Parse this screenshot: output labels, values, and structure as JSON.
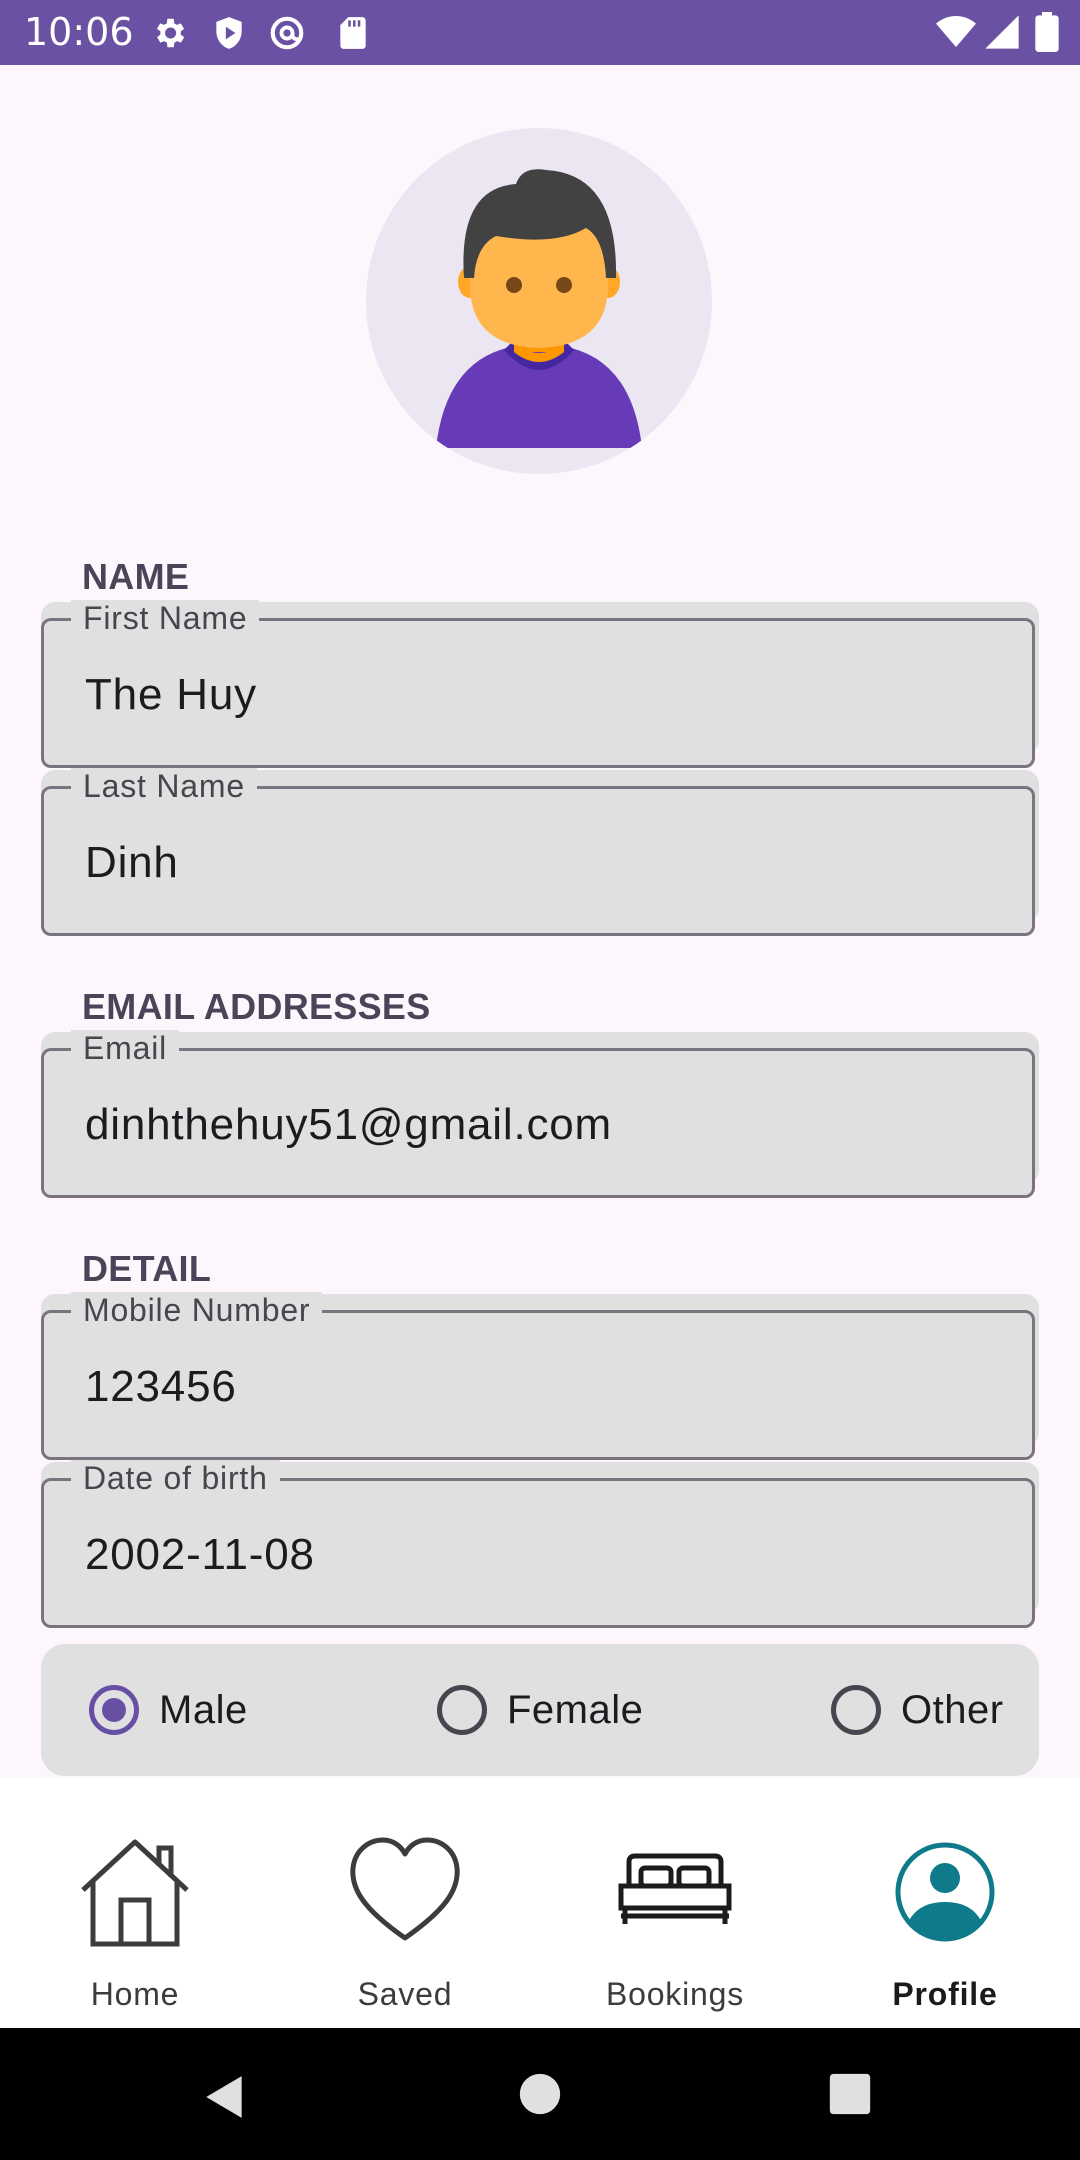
{
  "status_bar": {
    "time": "10:06",
    "icons": [
      "gear-icon",
      "shield-icon",
      "at-sign-icon",
      "sd-card-icon",
      "wifi-icon",
      "signal-icon",
      "battery-icon"
    ]
  },
  "avatar": {
    "icon": "user-avatar"
  },
  "sections": {
    "name": "NAME",
    "email": "EMAIL ADDRESSES",
    "detail": "DETAIL"
  },
  "fields": {
    "first_name": {
      "label": "First Name",
      "value": "The Huy"
    },
    "last_name": {
      "label": "Last Name",
      "value": "Dinh"
    },
    "email": {
      "label": "Email",
      "value": "dinhthehuy51@gmail.com"
    },
    "mobile": {
      "label": "Mobile Number",
      "value": "123456"
    },
    "dob": {
      "label": "Date of birth",
      "value": "2002-11-08"
    }
  },
  "gender": {
    "options": [
      "Male",
      "Female",
      "Other"
    ],
    "selected": "Male"
  },
  "bottom_nav": {
    "items": [
      {
        "label": "Home",
        "icon": "home-icon"
      },
      {
        "label": "Saved",
        "icon": "heart-icon"
      },
      {
        "label": "Bookings",
        "icon": "bed-icon"
      },
      {
        "label": "Profile",
        "icon": "profile-icon"
      }
    ],
    "active": "Profile"
  },
  "colors": {
    "status_bar": "#6b51a3",
    "accent": "#6750a4",
    "profile_icon": "#0e7a8a",
    "background": "#fdf7fd"
  }
}
